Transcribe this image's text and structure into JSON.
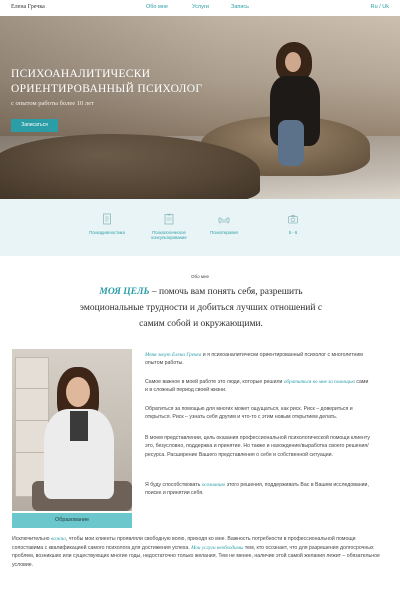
{
  "header": {
    "brand": "Елена Гречка",
    "nav": [
      "Обо мне",
      "Услуги",
      "Запись"
    ],
    "language": "Ru / Uk"
  },
  "hero": {
    "title": "ПСИХОАНАЛИТИЧЕСКИ ОРИЕНТИРОВАННЫЙ ПСИХОЛОГ",
    "subtitle": "с опытом работы более 10 лет",
    "button": "Записаться"
  },
  "features": [
    {
      "icon": "document-icon",
      "label": "Психодиагностика"
    },
    {
      "icon": "clipboard-icon",
      "label": "Психологическое консультирование"
    },
    {
      "icon": "sofa-icon",
      "label": "Психотерапия"
    },
    {
      "icon": "camera-icon",
      "label": "5 - 6"
    }
  ],
  "about": {
    "heading": "Обо мне",
    "mission_highlight": "МОЯ ЦЕЛЬ",
    "mission_text": " – помочь вам понять себя, разрешить эмоциональные трудности и добиться лучших отношений с самим собой и окружающими.",
    "photo_button": "Образование",
    "p1_highlight": "Меня зовут Елена Гречка",
    "p1_text": " и я психоаналитически ориентированный психолог с многолетним опытом работы.",
    "p2_a": "Самое важное в моей работе это люди, которые решили ",
    "p2_highlight": "обратиться ко мне за помощью",
    "p2_b": " сами и в сложный период своей жизни.",
    "p3": "Обратиться за помощью для многих может ощущаться, как риск. Риск – довериться и открыться. Риск – узнать себя другим и что-то с этим новым открытием делать.",
    "p4": "В моем представлении, цель оказания профессиональной психологической помощи клиенту это, безусловно, поддержка и принятие. Но также и нахождение/выработка своего решения/ресурса. Расширение Вашего представления о себе и собственной ситуации.",
    "p5_a": "Я буду способствовать ",
    "p5_highlight": "осознанию",
    "p5_b": " этого решения, поддерживать Вас в Вашем исследовании, поиске и принятии себя.",
    "bottom_a": "Исключительно ",
    "bottom_highlight1": "важно",
    "bottom_b": ", чтобы мои клиенты проявляли свободную волю, приходя ко мне. Важность потребности в профессиональной помощи сопоставима с квалификацией самого психолога для достижения успеха. ",
    "bottom_highlight2": "Мои услуги необходимы",
    "bottom_c": " тем, кто осознает, что для разрешения долгосрочных проблем, возникших или существующих многие годы, недостаточно только желания. Тем не менее, наличие этой самой желания лежит – обязательное условие."
  }
}
